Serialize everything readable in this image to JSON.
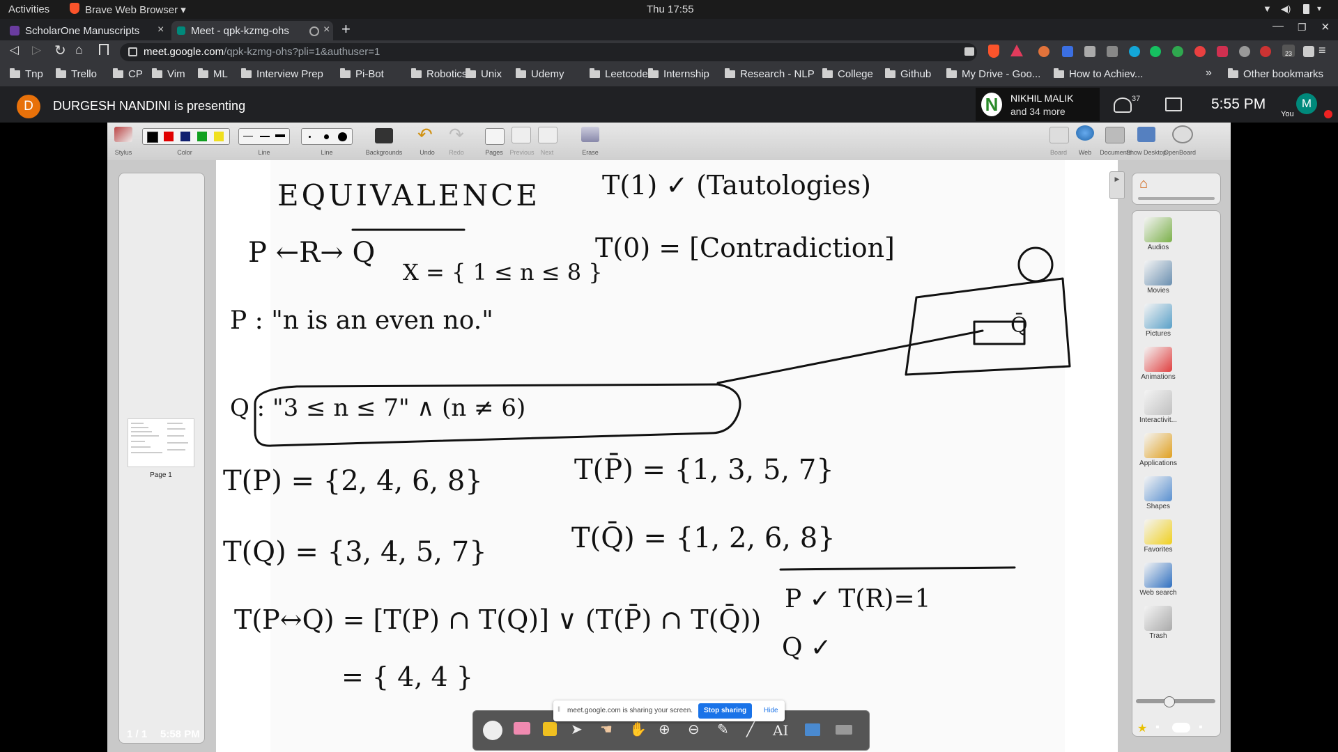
{
  "system_bar": {
    "activities": "Activities",
    "app_name": "Brave Web Browser",
    "clock": "Thu 17:55"
  },
  "tabs": [
    {
      "label": "ScholarOne Manuscripts",
      "active": false
    },
    {
      "label": "Meet - qpk-kzmg-ohs",
      "active": true
    }
  ],
  "address": {
    "host": "meet.google.com",
    "path": "/qpk-kzmg-ohs?pli=1&authuser=1",
    "ext_badge": "23"
  },
  "bookmarks": [
    "Tnp",
    "Trello",
    "CP",
    "Vim",
    "ML",
    "Interview Prep",
    "Pi-Bot",
    "Robotics",
    "Unix",
    "Udemy",
    "Leetcode",
    "Internship",
    "Research - NLP",
    "College",
    "Github",
    "My Drive - Goo...",
    "How to Achiev..."
  ],
  "bookmarks_overflow": "»",
  "other_bookmarks": "Other bookmarks",
  "meet": {
    "presenter_initial": "D",
    "presenter_text": "DURGESH NANDINI is presenting",
    "participant_name": "NIKHIL MALIK",
    "participant_more": "and 34 more",
    "participant_count": "37",
    "time": "5:55 PM",
    "self_initial": "M",
    "self_label": "You"
  },
  "openboard": {
    "tools": [
      "Stylus",
      "Color",
      "Line",
      "Eraser",
      "Backgrounds",
      "Undo",
      "Redo",
      "Pages",
      "Previous",
      "Next",
      "Erase"
    ],
    "right_tools": [
      "Board",
      "Web",
      "Documents",
      "Show Desktop",
      "OpenBoard"
    ],
    "colors": [
      "#000000",
      "#e00000",
      "#102070",
      "#10a020",
      "#f0e020"
    ],
    "page_label": "Page 1",
    "page_counter": "1 / 1",
    "page_time": "5:58 PM",
    "library": [
      "Audios",
      "Movies",
      "Pictures",
      "Animations",
      "Interactivit...",
      "Applications",
      "Shapes",
      "Favorites",
      "Web search",
      "Trash"
    ]
  },
  "whiteboard": {
    "title": "EQUIVALENCE",
    "lines": [
      "P ←R→ Q",
      "X = { 1 ≤ n ≤ 8 }",
      "P : \"n is an even no.\"",
      "Q : \"3 ≤ n ≤ 7\" ∧ (n ≠ 6)",
      "T(1) ✓ (Tautologies)",
      "T(0) = [Contradiction]",
      "T(P) = {2, 4, 6, 8}",
      "T(P̄) = {1, 3, 5, 7}",
      "T(Q) = {3, 4, 5, 7}",
      "T(Q̄) = {1, 2, 6, 8}",
      "T(P↔Q) = [T(P) ∩ T(Q)] ∨ (T(P̄) ∩ T(Q̄))",
      "= { 4, 4 }",
      "P ✓  T(R)=1",
      "Q ✓"
    ]
  },
  "share_notice": {
    "text": "meet.google.com is sharing your screen.",
    "stop_label": "Stop sharing",
    "hide_label": "Hide"
  }
}
